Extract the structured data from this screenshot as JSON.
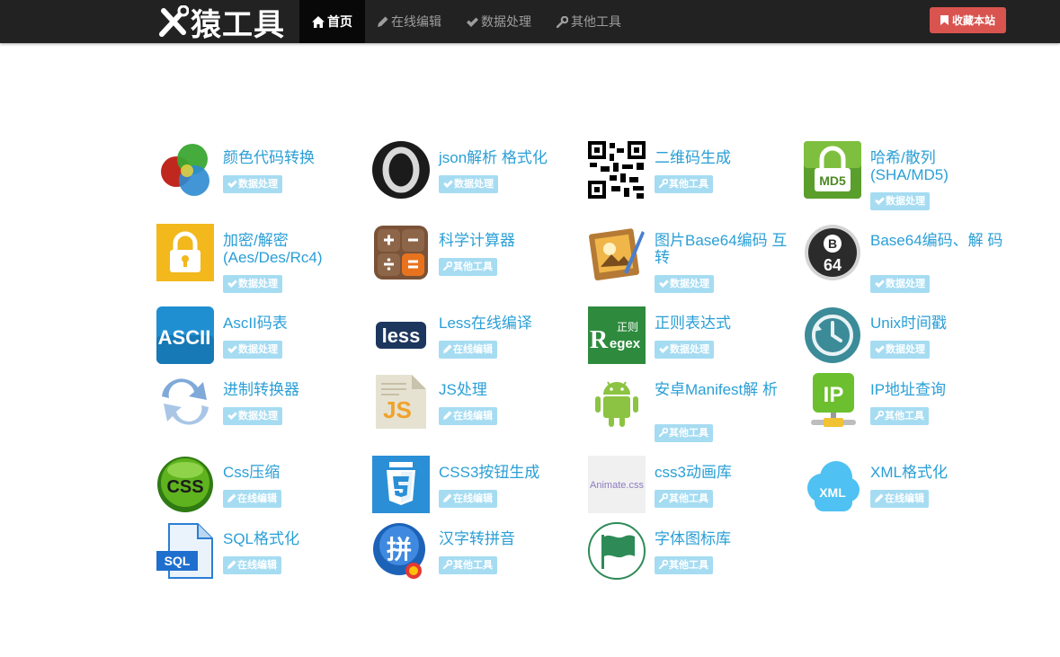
{
  "brand": {
    "logo_text": "猿工具"
  },
  "nav": [
    {
      "label": "首页",
      "icon": "home-icon",
      "active": true
    },
    {
      "label": "在线编辑",
      "icon": "pencil-icon",
      "active": false
    },
    {
      "label": "数据处理",
      "icon": "check-icon",
      "active": false
    },
    {
      "label": "其他工具",
      "icon": "wrench-icon",
      "active": false
    }
  ],
  "favorite_button": {
    "label": "收藏本站",
    "icon": "bookmark-icon"
  },
  "colors": {
    "navbar": "#222222",
    "link": "#2a9fd6",
    "tag": "#a6dcf2",
    "fav": "#d9534f"
  },
  "tools": [
    {
      "title": "颜色代码转换",
      "tag": "数据处理",
      "icon": "color-circles-icon"
    },
    {
      "title": "json解析 格式化",
      "tag": "数据处理",
      "icon": "json-ring-icon"
    },
    {
      "title": "二维码生成",
      "tag": "其他工具",
      "icon": "qrcode-icon"
    },
    {
      "title": "哈希/散列 (SHA/MD5)",
      "tag": "数据处理",
      "icon": "md5-lock-icon"
    },
    {
      "title": "加密/解密 (Aes/Des/Rc4)",
      "tag": "数据处理",
      "icon": "padlock-icon"
    },
    {
      "title": "科学计算器",
      "tag": "其他工具",
      "icon": "calculator-icon"
    },
    {
      "title": "图片Base64编码 互转",
      "tag": "数据处理",
      "icon": "image-pen-icon"
    },
    {
      "title": "Base64编码、解 码",
      "tag": "数据处理",
      "icon": "base64-ball-icon"
    },
    {
      "title": "AscII码表",
      "tag": "数据处理",
      "icon": "ascii-icon"
    },
    {
      "title": "Less在线编译",
      "tag": "在线编辑",
      "icon": "less-icon"
    },
    {
      "title": "正则表达式",
      "tag": "数据处理",
      "icon": "regex-icon"
    },
    {
      "title": "Unix时间戳",
      "tag": "数据处理",
      "icon": "clock-icon"
    },
    {
      "title": "进制转换器",
      "tag": "数据处理",
      "icon": "swap-arrows-icon"
    },
    {
      "title": "JS处理",
      "tag": "在线编辑",
      "icon": "js-file-icon"
    },
    {
      "title": "安卓Manifest解 析",
      "tag": "其他工具",
      "icon": "android-icon"
    },
    {
      "title": "IP地址查询",
      "tag": "其他工具",
      "icon": "ip-icon"
    },
    {
      "title": "Css压缩",
      "tag": "在线编辑",
      "icon": "css-ball-icon"
    },
    {
      "title": "CSS3按钮生成",
      "tag": "在线编辑",
      "icon": "css3-shield-icon"
    },
    {
      "title": "css3动画库",
      "tag": "其他工具",
      "icon": "animate-css-icon"
    },
    {
      "title": "XML格式化",
      "tag": "在线编辑",
      "icon": "xml-cloud-icon"
    },
    {
      "title": "SQL格式化",
      "tag": "在线编辑",
      "icon": "sql-file-icon"
    },
    {
      "title": "汉字转拼音",
      "tag": "其他工具",
      "icon": "pinyin-icon"
    },
    {
      "title": "字体图标库",
      "tag": "其他工具",
      "icon": "flag-icon"
    }
  ]
}
